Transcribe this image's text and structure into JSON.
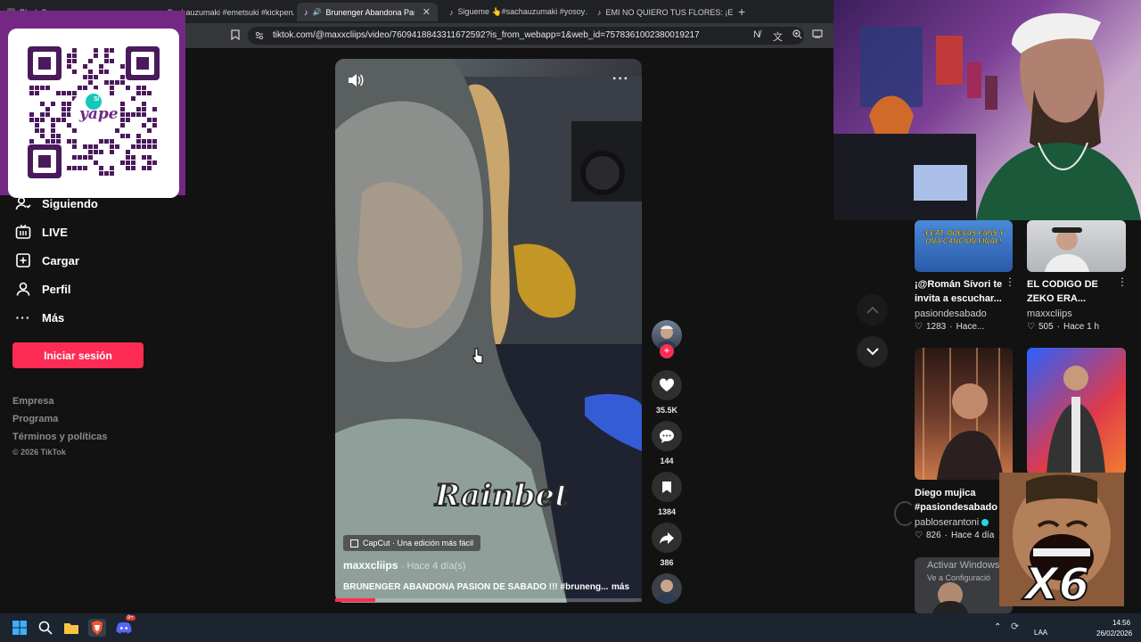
{
  "browser": {
    "tabs": [
      {
        "title": "Black S…",
        "active": false
      },
      {
        "title": "S... hauzumaki #emetsuki #kickperu…",
        "active": false
      },
      {
        "title": "Brunenger Abandona Pasión…",
        "active": true
      },
      {
        "title": "Sigueme 👆#sachauzumaki #yosoy…",
        "active": false
      },
      {
        "title": "EMI NO QUIERO TUS FLORES: ¡Enté…",
        "active": false
      }
    ],
    "url": "tiktok.com/@maxxcliips/video/7609418843311672592?is_from_webapp=1&web_id=7578361002380019217"
  },
  "qr": {
    "brand": "yape",
    "badge": "S/"
  },
  "sidebar": {
    "items": [
      {
        "label": "Siguiendo",
        "icon": "following-icon"
      },
      {
        "label": "LIVE",
        "icon": "live-icon"
      },
      {
        "label": "Cargar",
        "icon": "upload-icon"
      },
      {
        "label": "Perfil",
        "icon": "profile-icon"
      },
      {
        "label": "Más",
        "icon": "more-icon"
      }
    ],
    "login_label": "Iniciar sesión",
    "footer": [
      "Empresa",
      "Programa",
      "Términos y políticas"
    ],
    "copyright": "© 2026 TikTok"
  },
  "video": {
    "watermark": "Rainbet",
    "capcut_label": "CapCut · Una edición más fácil",
    "author": "maxxcliips",
    "time_ago": "· Hace 4 día(s)",
    "caption": "BRUNENGER ABANDONA PASION DE SABADO !!! #bruneng...",
    "more_label": "más",
    "progress_fraction": 0.13
  },
  "actions": {
    "likes": "35.5K",
    "comments": "144",
    "saves": "1384",
    "shares": "386"
  },
  "related": [
    {
      "title": "¡@Román Sívori te invita a escuchar...",
      "author": "pasiondesabado",
      "likes": "1283",
      "time": "Hace...",
      "thumb_text": "¡FEAT, NUEVAS FANS Y UNA CANCIÓN FINAL!"
    },
    {
      "title": "EL CODIGO DE ZEKO ERA...",
      "author": "maxxcliips",
      "likes": "505",
      "time": "Hace 1 h",
      "thumb_text": ""
    },
    {
      "title": "Diego mujica #pasiondesabado",
      "author": "pabloserantoni",
      "likes": "826",
      "time": "Hace 4 día",
      "thumb_text": ""
    },
    {
      "title": "",
      "author": "",
      "likes": "",
      "time": "",
      "thumb_text": ""
    }
  ],
  "activate_windows": {
    "line1": "Activar Windows",
    "line2": "Ve a Configuració"
  },
  "emote": {
    "text": "X6"
  },
  "taskbar": {
    "lang": "LAA",
    "time": "14:56",
    "date": "26/02/2026",
    "discord_badge": "9+"
  },
  "colors": {
    "accent": "#fe2c55",
    "yape": "#742884"
  }
}
